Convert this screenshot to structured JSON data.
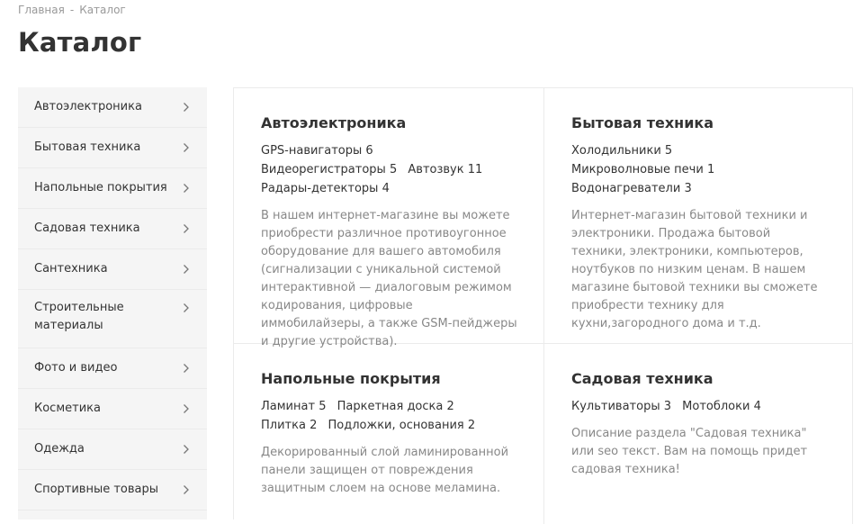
{
  "breadcrumb": {
    "home": "Главная",
    "separator": "-",
    "current": "Каталог"
  },
  "page_title": "Каталог",
  "sidebar": {
    "items": [
      {
        "label": "Автоэлектроника",
        "icon": "chevron-right-icon"
      },
      {
        "label": "Бытовая техника",
        "icon": "chevron-right-icon"
      },
      {
        "label": "Напольные покрытия",
        "icon": "chevron-right-icon"
      },
      {
        "label": "Садовая техника",
        "icon": "chevron-right-icon"
      },
      {
        "label": "Сантехника",
        "icon": "chevron-right-icon"
      },
      {
        "label": "Строительные материалы",
        "icon": "chevron-right-icon"
      },
      {
        "label": "Фото и видео",
        "icon": "chevron-right-icon"
      },
      {
        "label": "Косметика",
        "icon": "chevron-right-icon"
      },
      {
        "label": "Одежда",
        "icon": "chevron-right-icon"
      },
      {
        "label": "Спортивные товары",
        "icon": "chevron-right-icon"
      }
    ]
  },
  "cards": [
    {
      "title": "Автоэлектроника",
      "subcategories": [
        {
          "name": "GPS-навигаторы",
          "count": "6"
        },
        {
          "name": "Видеорегистраторы",
          "count": "5"
        },
        {
          "name": "Автозвук",
          "count": "11"
        },
        {
          "name": "Радары-детекторы",
          "count": "4"
        }
      ],
      "description": "В нашем интернет-магазине вы можете приобрести различное противоугонное оборудование для вашего автомобиля (сигнализации с уникальной системой интерактивной — диалоговым режимом кодирования, цифровые иммобилайзеры, а также GSM-пейджеры и другие устройства)."
    },
    {
      "title": "Бытовая техника",
      "subcategories": [
        {
          "name": "Холодильники",
          "count": "5"
        },
        {
          "name": "Микроволновые печи",
          "count": "1"
        },
        {
          "name": "Водонагреватели",
          "count": "3"
        }
      ],
      "description": "Интернет-магазин бытовой техники и электроники. Продажа бытовой техники, электроники, компьютеров, ноутбуков по низким ценам. В нашем магазине бытовой техники вы сможете приобрести технику для кухни,загородного дома и т.д."
    },
    {
      "title": "Напольные покрытия",
      "subcategories": [
        {
          "name": "Ламинат",
          "count": "5"
        },
        {
          "name": "Паркетная доска",
          "count": "2"
        },
        {
          "name": "Плитка",
          "count": "2"
        },
        {
          "name": "Подложки, основания",
          "count": "2"
        }
      ],
      "description": "Декорированный слой ламинированной панели защищен от повреждения защитным слоем на основе меламина."
    },
    {
      "title": "Садовая техника",
      "subcategories": [
        {
          "name": "Культиваторы",
          "count": "3"
        },
        {
          "name": "Мотоблоки",
          "count": "4"
        }
      ],
      "description": "Описание раздела \"Садовая техника\" или seo текст. Вам на помощь придет садовая техника!"
    }
  ],
  "colors": {
    "text": "#333333",
    "muted": "#888888",
    "breadcrumb": "#999999",
    "sidebar_bg": "#f5f5f5",
    "border": "#ebebeb"
  }
}
